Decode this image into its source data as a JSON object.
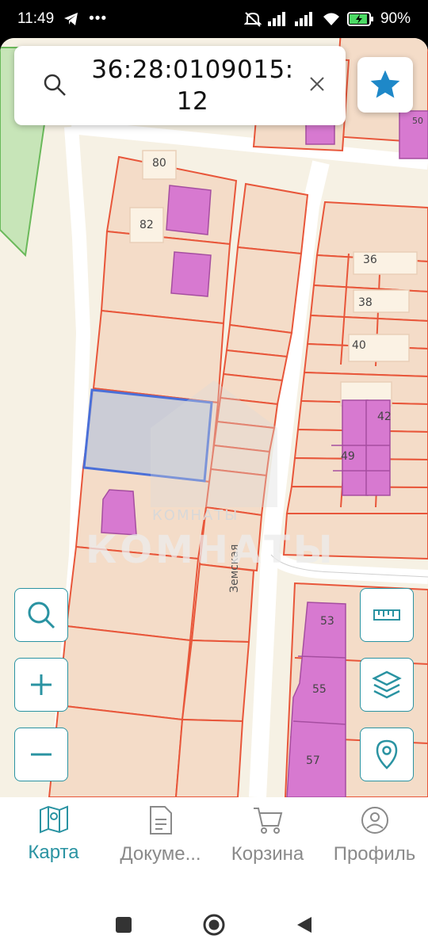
{
  "status": {
    "time": "11:49",
    "battery": "90"
  },
  "search": {
    "query_line1": "36:28:0109015:",
    "query_line2": "12"
  },
  "map": {
    "street": "Земская",
    "watermark_small": "КОМНАТЫ",
    "watermark_big": "КОМНАТЫ",
    "house_numbers": [
      "80",
      "82",
      "36",
      "38",
      "40",
      "42",
      "49",
      "53",
      "55",
      "57",
      "50"
    ]
  },
  "nav": {
    "items": [
      {
        "label": "Карта",
        "icon": "map-icon",
        "active": true
      },
      {
        "label": "Докуме...",
        "icon": "document-icon",
        "active": false
      },
      {
        "label": "Корзина",
        "icon": "cart-icon",
        "active": false
      },
      {
        "label": "Профиль",
        "icon": "profile-icon",
        "active": false
      }
    ]
  },
  "colors": {
    "accent": "#2a93a2",
    "parcel_line": "#e8563a",
    "building": "#d779d0",
    "selected": "#4a6fd8",
    "star": "#1e88c8"
  }
}
